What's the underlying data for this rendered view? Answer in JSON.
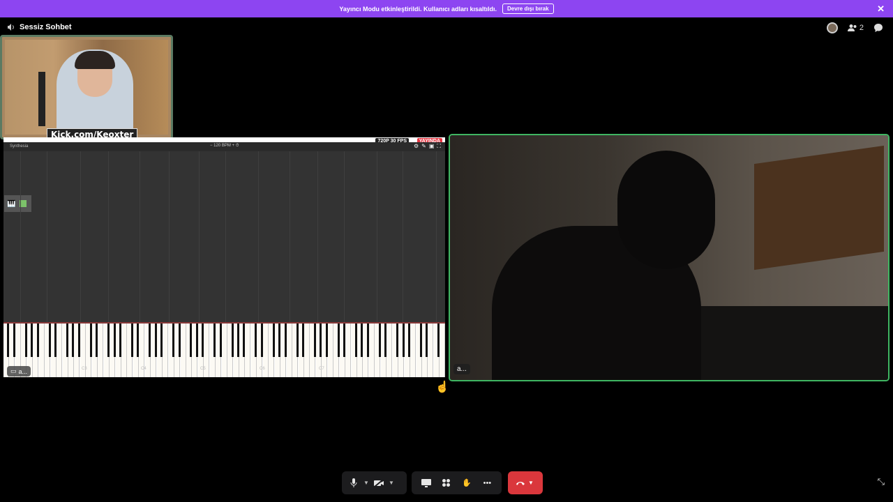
{
  "banner": {
    "message": "Yayıncı Modu etkinleştirildi. Kullanıcı adları kısaltıldı.",
    "disable_label": "Devre dışı bırak",
    "close_glyph": "✕"
  },
  "channel": {
    "name": "Sessiz Sohbet",
    "icon": "speaker-icon"
  },
  "header": {
    "participant_count": "2"
  },
  "stream_overlay": {
    "webcam_label": "Kick.com/Keoxter"
  },
  "screen_share": {
    "app_title": "Synthesia",
    "tempo": "120 BPM",
    "quality_badge": "720P 30 FPS",
    "live_badge": "YAYINDA",
    "participant_label": "a...",
    "key_labels": [
      "C3",
      "C4",
      "C5",
      "C6",
      "C7"
    ]
  },
  "video_tile": {
    "participant_label": "a..."
  },
  "colors": {
    "banner": "#8d45f1",
    "speaking_outline": "#3fb662",
    "hangup": "#da373c",
    "live_badge": "#e53743"
  },
  "controls": {
    "mic": "microphone-icon",
    "camera": "camera-off-icon",
    "share": "screen-share-icon",
    "activities": "activities-icon",
    "soundboard": "soundboard-icon",
    "more": "more-icon",
    "hangup": "hangup-icon",
    "fullscreen": "exit-fullscreen-icon"
  }
}
